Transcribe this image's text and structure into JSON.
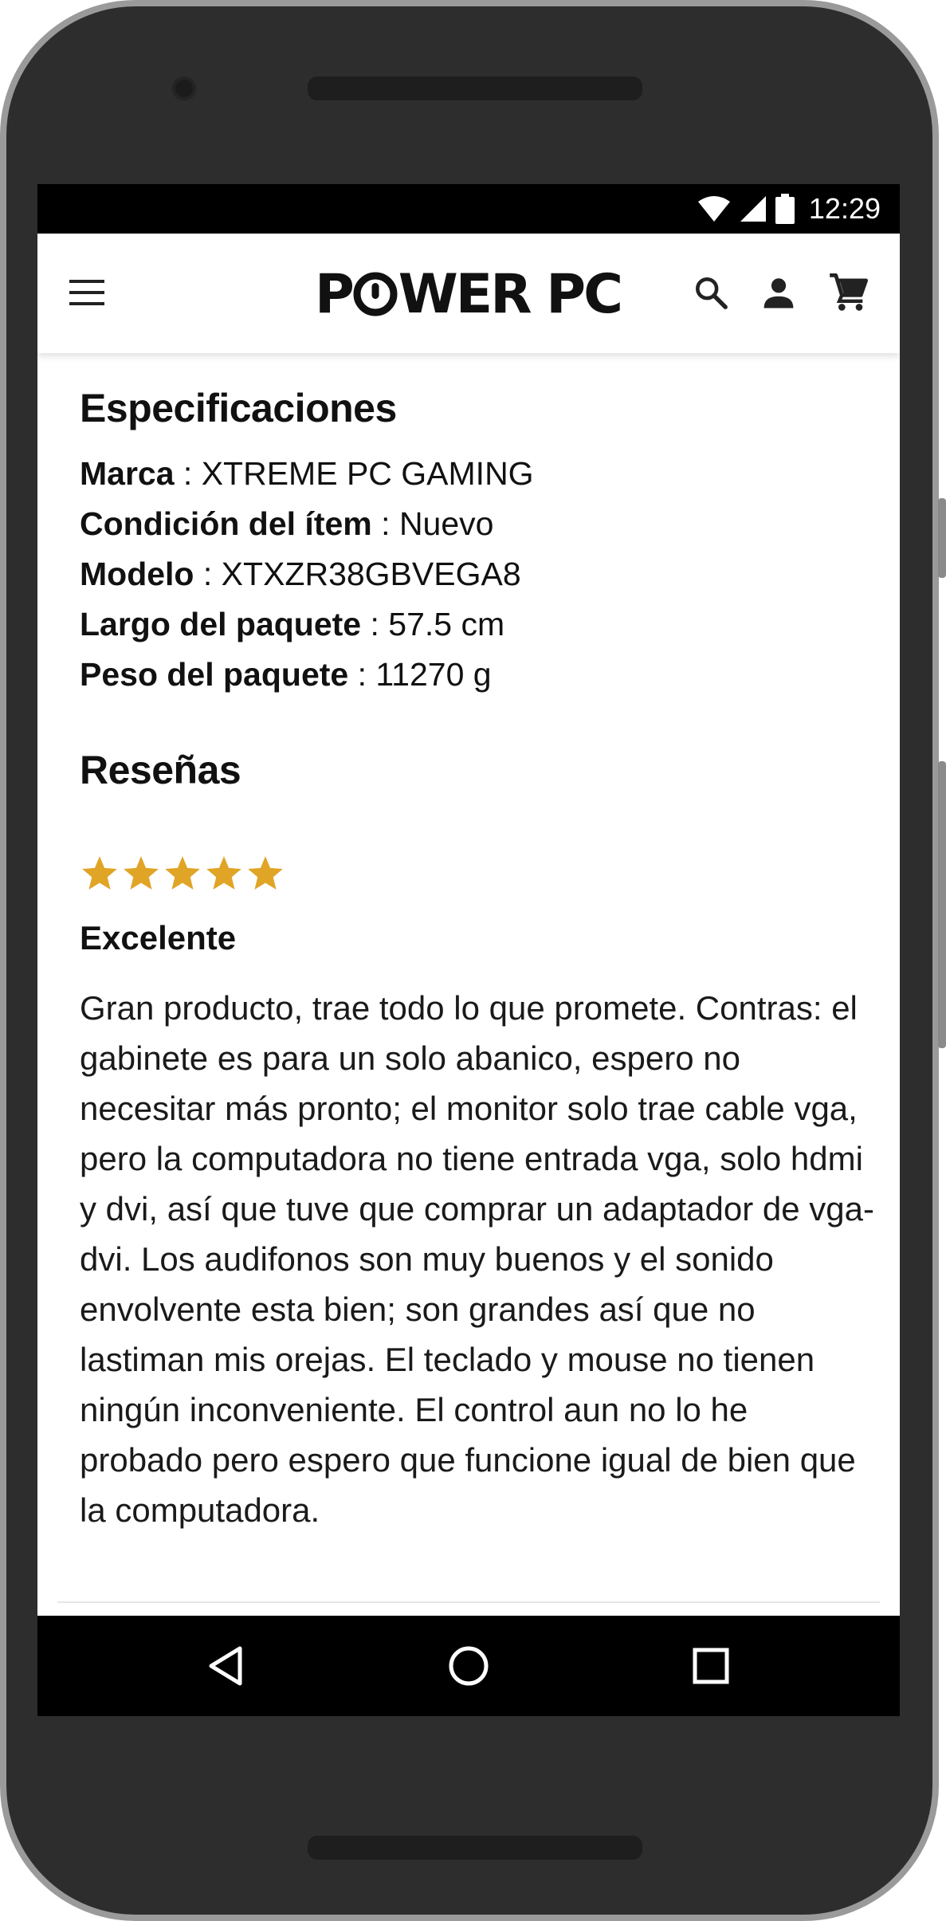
{
  "status_bar": {
    "time": "12:29",
    "icons": [
      "wifi-icon",
      "cell-signal-icon",
      "battery-icon"
    ]
  },
  "app_bar": {
    "logo_text_left": "P",
    "logo_text_right": "WER PC",
    "icons": [
      "menu-icon",
      "search-icon",
      "account-icon",
      "cart-icon"
    ]
  },
  "specs": {
    "title": "Especificaciones",
    "rows": [
      {
        "label": "Marca",
        "value": "XTREME PC GAMING"
      },
      {
        "label": "Condición del ítem",
        "value": "Nuevo"
      },
      {
        "label": "Modelo",
        "value": "XTXZR38GBVEGA8"
      },
      {
        "label": "Largo del paquete",
        "value": "57.5 cm"
      },
      {
        "label": "Peso del paquete",
        "value": "11270 g"
      }
    ],
    "separator": " : "
  },
  "reviews": {
    "title": "Reseñas",
    "items": [
      {
        "rating": 5,
        "rating_max": 5,
        "title": "Excelente",
        "body": "Gran producto, trae todo lo que promete. Contras: el gabinete es para un solo abanico, espero no necesitar más pronto; el monitor solo trae cable vga, pero la computadora no tiene entrada vga, solo hdmi y dvi, así que tuve que comprar un adaptador de vga-dvi. Los audifonos son muy buenos y el sonido envolvente esta bien; son grandes así que no lastiman mis orejas. El teclado y mouse no tienen ningún inconveniente. El control aun no lo he probado pero espero que funcione igual de bien que la computadora."
      }
    ]
  },
  "colors": {
    "star": "#E0A526",
    "phone_body": "#2d2d2d",
    "text": "#111111"
  },
  "nav_bar": {
    "icons": [
      "back-icon",
      "home-icon",
      "recents-icon"
    ]
  }
}
